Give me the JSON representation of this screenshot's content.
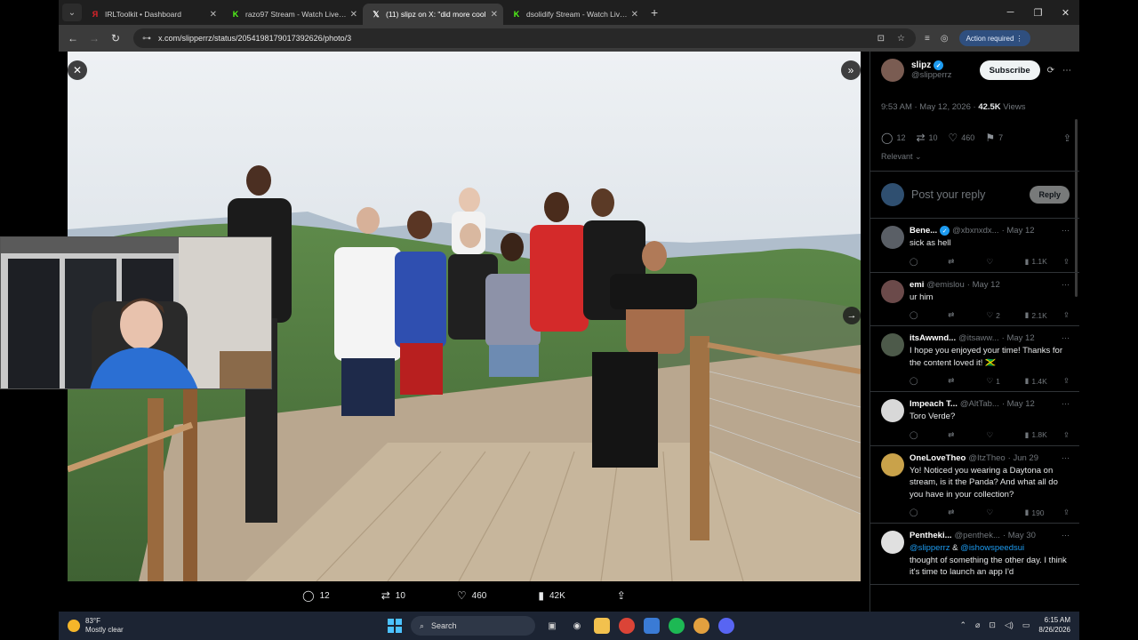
{
  "browser": {
    "tabs": [
      {
        "title": "IRLToolkit • Dashboard",
        "favicon": "irltoolkit-icon",
        "color": "#e2232a",
        "active": false
      },
      {
        "title": "razo97 Stream - Watch Live on Kick",
        "favicon": "kick-icon",
        "color": "#53fc18",
        "active": false
      },
      {
        "title": "(11) slipz on X: \"did more cool",
        "favicon": "x-icon",
        "color": "#ffffff",
        "active": true
      },
      {
        "title": "dsolidify Stream - Watch Live on Kick",
        "favicon": "kick-icon",
        "color": "#53fc18",
        "active": false
      }
    ],
    "url": "x.com/slipperrz/status/2054198179017392626/photo/3",
    "action_required": "Action required"
  },
  "viewer": {
    "replies": "12",
    "reposts": "10",
    "likes": "460",
    "views": "42K"
  },
  "tweet": {
    "author_name": "slipz",
    "author_handle": "@slipperrz",
    "subscribe_label": "Subscribe",
    "time": "9:53 AM · May 12, 2026 · ",
    "views_count": "42.5K",
    "views_label": " Views",
    "replies": "12",
    "reposts": "10",
    "likes": "460",
    "bookmarks": "7",
    "sort_label": "Relevant",
    "reply_placeholder": "Post your reply",
    "reply_button": "Reply"
  },
  "replies": [
    {
      "name": "Bene...",
      "verified": true,
      "handle": "@xbxnxdx...",
      "date": "· May 12",
      "text": "sick as hell",
      "replies": "",
      "reposts": "",
      "likes": "",
      "views": "1.1K",
      "avatar": "#5a5f66"
    },
    {
      "name": "emi",
      "verified": false,
      "handle": "@emislou",
      "date": "· May 12",
      "text": "ur him",
      "replies": "",
      "reposts": "",
      "likes": "2",
      "views": "2.1K",
      "avatar": "#6b4a4a"
    },
    {
      "name": "itsAwwnd...",
      "verified": false,
      "handle": "@itsaww...",
      "date": "· May 12",
      "text": "I hope you enjoyed your time! Thanks for the content loved it! 🇯🇲",
      "replies": "",
      "reposts": "",
      "likes": "1",
      "views": "1.4K",
      "avatar": "#4d5a4a"
    },
    {
      "name": "Impeach T...",
      "verified": false,
      "handle": "@AltTab...",
      "date": "· May 12",
      "text": "Toro Verde?",
      "replies": "",
      "reposts": "",
      "likes": "",
      "views": "1.8K",
      "avatar": "#d8d8d8"
    },
    {
      "name": "OneLoveTheo",
      "verified": false,
      "handle": "@ItzTheo",
      "date": "· Jun 29",
      "text": "Yo! Noticed you wearing a Daytona on stream, is it the Panda? And what all do you have in your collection?",
      "replies": "",
      "reposts": "",
      "likes": "",
      "views": "190",
      "avatar": "#c9a24a"
    },
    {
      "name": "Pentheki...",
      "verified": false,
      "handle": "@penthek...",
      "date": "· May 30",
      "mention1": "@slipperrz",
      "amp": " & ",
      "mention2": "@ishowspeedsui",
      "text": "thought of something the other day. I think it's time to launch an app I'd",
      "replies": "",
      "reposts": "",
      "likes": "",
      "views": "",
      "avatar": "#e0e0e0"
    }
  ],
  "taskbar": {
    "temp": "83°F",
    "condition": "Mostly clear",
    "search": "Search",
    "time": "6:15 AM",
    "date": "8/26/2026"
  }
}
